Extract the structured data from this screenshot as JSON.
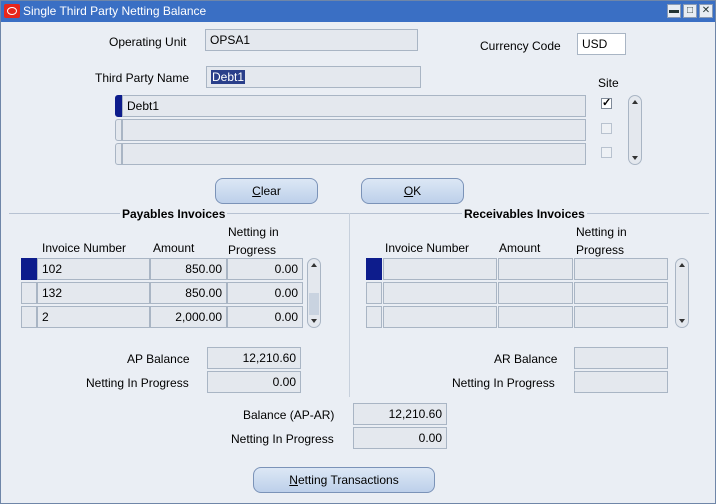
{
  "window": {
    "title": "Single Third Party Netting Balance",
    "minimize_glyph": "▬",
    "maximize_glyph": "□",
    "close_glyph": "✕"
  },
  "header": {
    "operating_unit_label": "Operating Unit",
    "operating_unit_value": "OPSA1",
    "currency_code_label": "Currency Code",
    "currency_code_value": "USD",
    "third_party_name_label": "Third Party Name",
    "third_party_name_value": "Debt1",
    "site_label": "Site"
  },
  "third_party_rows": [
    {
      "name": "Debt1",
      "site_checked": true
    },
    {
      "name": "",
      "site_checked": false
    },
    {
      "name": "",
      "site_checked": false
    }
  ],
  "buttons": {
    "clear_prefix": "",
    "clear_underlined": "C",
    "clear_rest": "lear",
    "ok_prefix": "",
    "ok_underlined": "O",
    "ok_rest": "K",
    "netting_prefix": "",
    "netting_underlined": "N",
    "netting_rest": "etting Transactions"
  },
  "payables": {
    "title": "Payables Invoices",
    "col_invoice": "Invoice Number",
    "col_amount": "Amount",
    "col_netting_line1": "Netting in",
    "col_netting_line2": "Progress",
    "rows": [
      {
        "invoice": "102",
        "amount": "850.00",
        "netting": "0.00"
      },
      {
        "invoice": "132",
        "amount": "850.00",
        "netting": "0.00"
      },
      {
        "invoice": "2",
        "amount": "2,000.00",
        "netting": "0.00"
      }
    ],
    "balance_label": "AP Balance",
    "balance_value": "12,210.60",
    "netting_label": "Netting In Progress",
    "netting_value": "0.00"
  },
  "receivables": {
    "title": "Receivables Invoices",
    "col_invoice": "Invoice Number",
    "col_amount": "Amount",
    "col_netting_line1": "Netting in",
    "col_netting_line2": "Progress",
    "balance_label": "AR Balance",
    "balance_value": "",
    "netting_label": "Netting In Progress",
    "netting_value": ""
  },
  "totals": {
    "balance_label": "Balance (AP-AR)",
    "balance_value": "12,210.60",
    "netting_label": "Netting In Progress",
    "netting_value": "0.00"
  }
}
